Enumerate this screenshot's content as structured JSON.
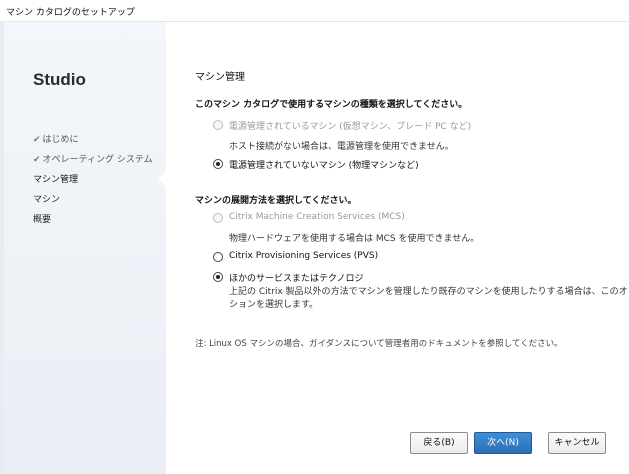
{
  "window": {
    "title": "マシン カタログのセットアップ"
  },
  "sidebar": {
    "brand": "Studio",
    "steps": [
      {
        "label": "はじめに",
        "state": "done"
      },
      {
        "label": "オペレーティング システム",
        "state": "done"
      },
      {
        "label": "マシン管理",
        "state": "current"
      },
      {
        "label": "マシン",
        "state": "pending"
      },
      {
        "label": "概要",
        "state": "pending"
      }
    ],
    "check_glyph": "✔"
  },
  "main": {
    "heading": "マシン管理",
    "question1": "このマシン カタログで使用するマシンの種類を選択してください。",
    "options1": [
      {
        "label": "電源管理されているマシン (仮想マシン、ブレード PC など)",
        "selected": false,
        "disabled": true,
        "sub": "ホスト接続がない場合は、電源管理を使用できません。"
      },
      {
        "label": "電源管理されていないマシン (物理マシンなど)",
        "selected": true,
        "disabled": false
      }
    ],
    "question2": "マシンの展開方法を選択してください。",
    "options2": [
      {
        "label": "Citrix Machine Creation Services (MCS)",
        "selected": false,
        "disabled": true,
        "sub": "物理ハードウェアを使用する場合は MCS を使用できません。"
      },
      {
        "label": "Citrix Provisioning Services (PVS)",
        "selected": false,
        "disabled": false
      },
      {
        "label": "ほかのサービスまたはテクノロジ",
        "selected": true,
        "disabled": false,
        "sub1": "上記の Citrix 製品以外の方法でマシンを管理したり既存のマシンを使用したりする場合は、このオプ",
        "sub2": "ションを選択します。"
      }
    ],
    "note": "注: Linux OS マシンの場合、ガイダンスについて管理者用のドキュメントを参照してください。"
  },
  "footer": {
    "back_label": "戻る(B)",
    "next_label": "次へ(N)",
    "cancel_label": "キャンセル"
  },
  "colors": {
    "primary_button": "#2b6fb4",
    "sidebar_bg": "#eef2f7"
  }
}
